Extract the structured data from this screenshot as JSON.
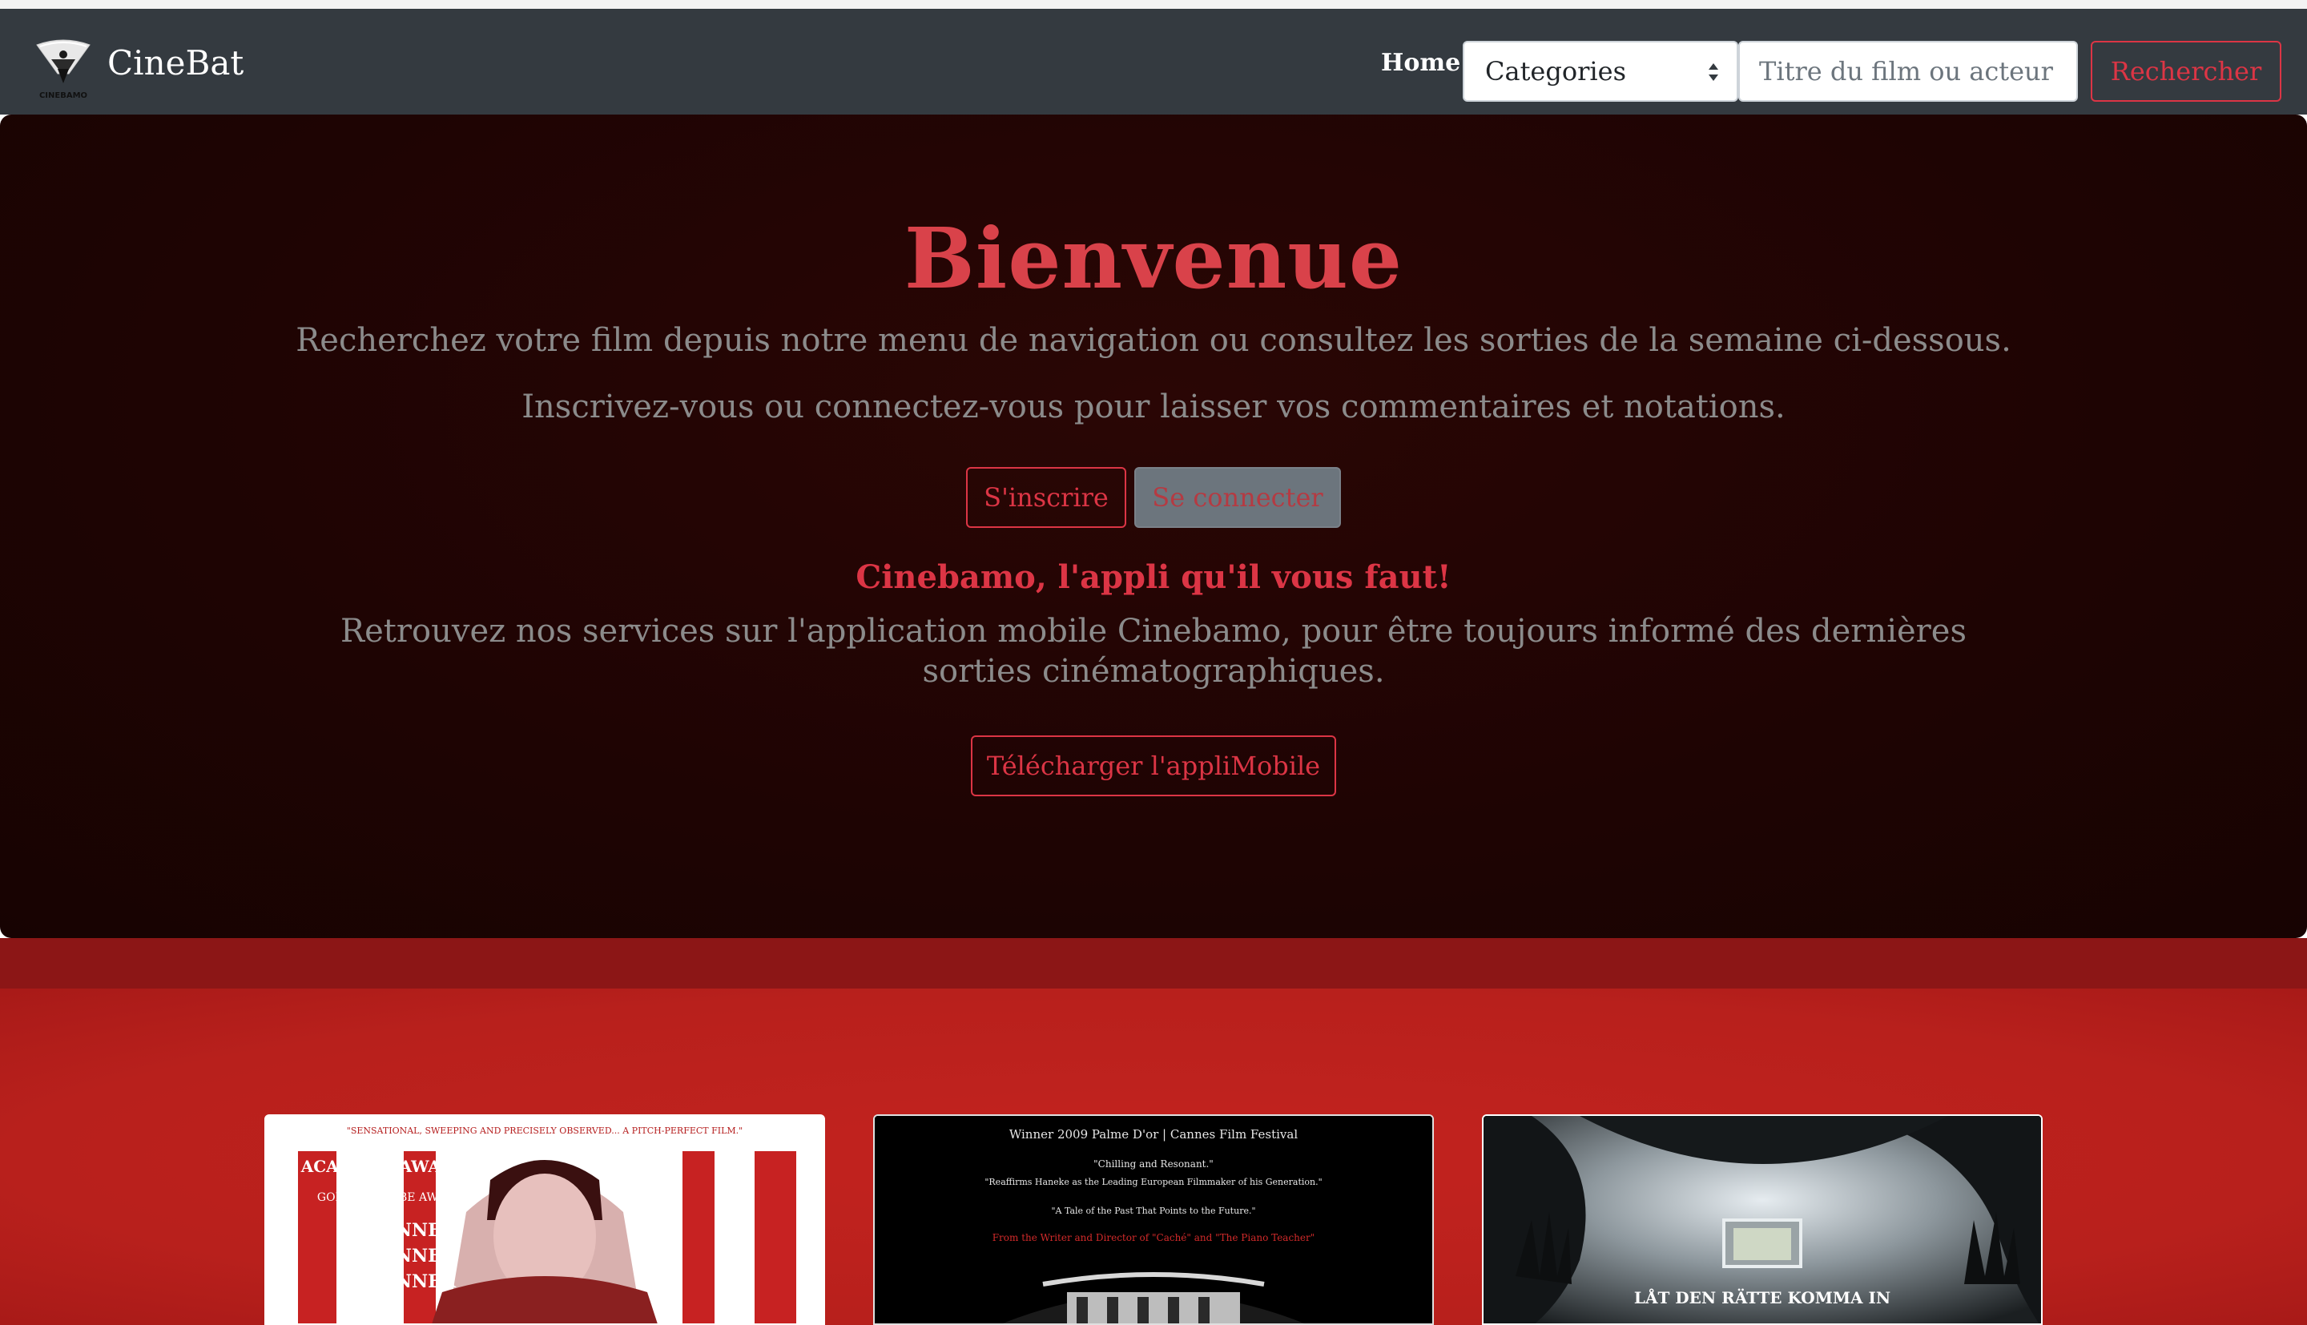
{
  "navbar": {
    "brand_name": "CineBat",
    "logo_text": "CINEBAMO",
    "home_label": "Home",
    "categories_selected": "Categories",
    "search_placeholder": "Titre du film ou acteur",
    "search_button": "Rechercher"
  },
  "hero": {
    "title": "Bienvenue",
    "lead1": "Recherchez votre film depuis notre menu de navigation ou consultez les sorties de la semaine ci-dessous.",
    "lead2": "Inscrivez-vous ou connectez-vous pour laisser vos commentaires et notations.",
    "signup_button": "S'inscrire",
    "login_button": "Se connecter",
    "app_title": "Cinebamo, l'appli qu'il vous faut!",
    "app_text": "Retrouvez nos services sur l'application mobile Cinebamo, pour être toujours informé des dernières sorties cinématographiques.",
    "download_button": "Télécharger l'appliMobile"
  },
  "movies": [
    {
      "tagline": "\"SENSATIONAL, SWEEPING AND PRECISELY OBSERVED... A PITCH-PERFECT FILM.\"",
      "nominated": "ACADEMY AWARDS",
      "award2": "GOLDEN GLOBE AWARD",
      "winner": "WINNER"
    },
    {
      "festival": "Winner 2009 Palme D'or | Cannes Film Festival",
      "quote1": "\"Chilling and Resonant.\"",
      "quote2": "\"Reaffirms Haneke as the Leading European Filmmaker of his Generation.\"",
      "quote3": "\"A Tale of the Past That Points to the Future.\"",
      "credit": "From the Writer and Director of \"Caché\" and \"The Piano Teacher\""
    },
    {
      "title": "LÅT DEN RÄTTE KOMMA IN"
    }
  ],
  "colors": {
    "navbar_bg": "#343a40",
    "accent": "#dc3545",
    "hero_bg": "#1e0403",
    "band_red": "#b8201c"
  }
}
